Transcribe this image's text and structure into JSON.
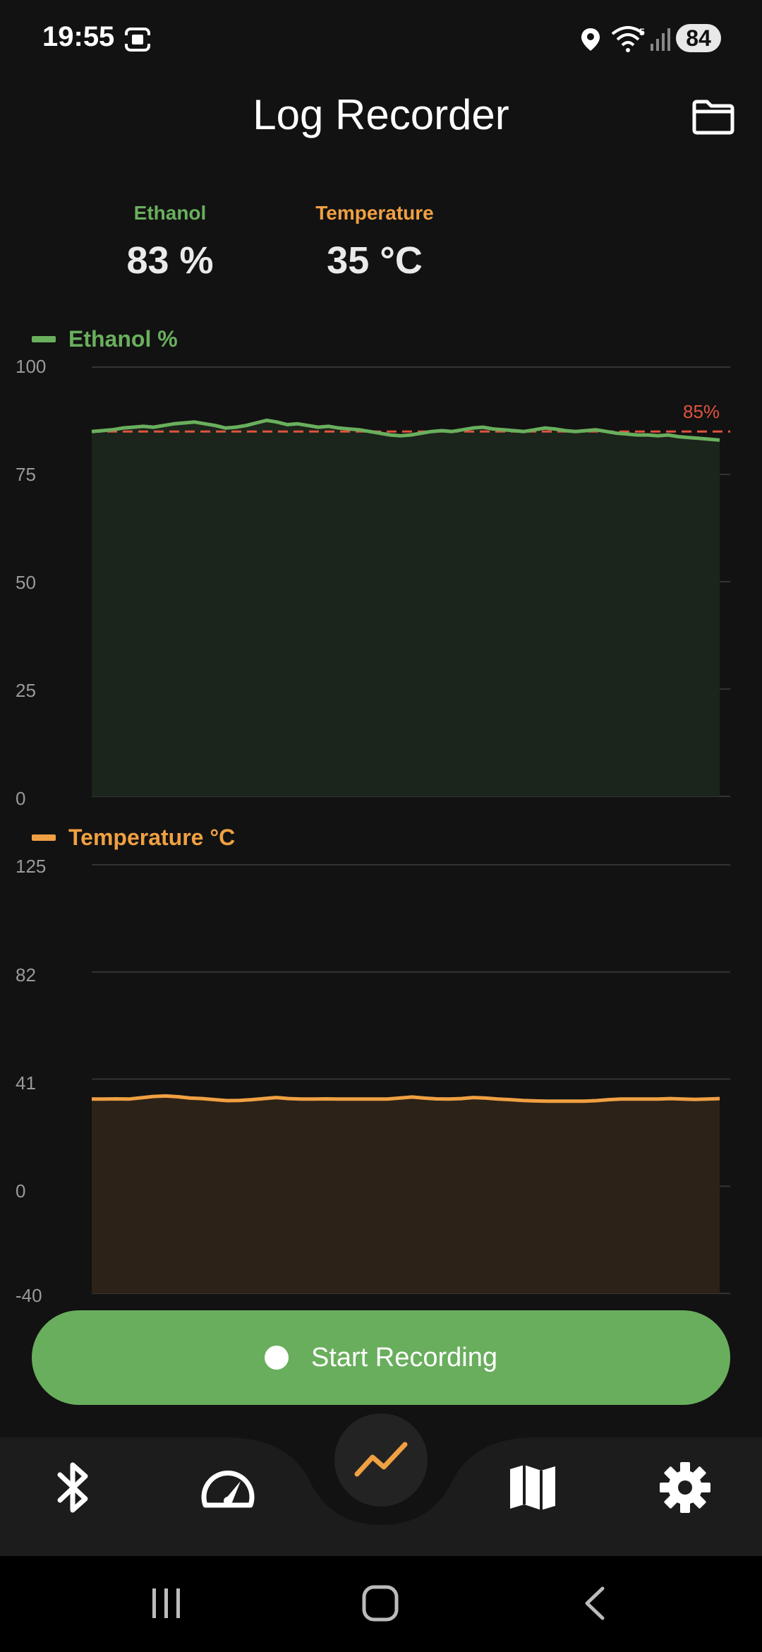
{
  "status_bar": {
    "time": "19:55",
    "battery": "84",
    "icons": [
      "screenshot-icon",
      "location-icon",
      "wifi-icon",
      "signal-icon"
    ]
  },
  "header": {
    "title": "Log Recorder",
    "folder_icon": "folder-icon"
  },
  "readouts": {
    "ethanol_label": "Ethanol",
    "ethanol_value": "83 %",
    "temperature_label": "Temperature",
    "temperature_value": "35 °C"
  },
  "colors": {
    "ethanol": "#6aaf5d",
    "temperature": "#f0a042",
    "threshold": "#e0533f",
    "record_button": "#69ae5d"
  },
  "chart_data": [
    {
      "type": "area",
      "legend": "Ethanol %",
      "yticks": [
        "100",
        "75",
        "50",
        "25",
        "0"
      ],
      "ylim": [
        0,
        100
      ],
      "threshold_label": "85%",
      "threshold": 85,
      "grid": true,
      "series": [
        {
          "values": [
            85,
            85.2,
            85.4,
            85.8,
            86,
            86.2,
            86,
            86.4,
            86.8,
            87,
            87.2,
            86.8,
            86.4,
            85.8,
            86,
            86.4,
            87,
            87.6,
            87.2,
            86.6,
            86.8,
            86.4,
            86,
            86.2,
            85.8,
            85.6,
            85.4,
            85,
            84.6,
            84.2,
            84,
            84.2,
            84.6,
            85,
            85.2,
            85,
            85.4,
            85.8,
            86,
            85.6,
            85.4,
            85.2,
            85,
            85.4,
            85.8,
            85.6,
            85.2,
            85,
            85.2,
            85.4,
            85,
            84.6,
            84.4,
            84.2,
            84.2,
            84,
            84.2,
            83.8,
            83.6,
            83.4,
            83.2,
            83
          ]
        }
      ]
    },
    {
      "type": "area",
      "legend": "Temperature °C",
      "yticks": [
        "125",
        "82",
        "41",
        "0",
        "-40"
      ],
      "ylim": [
        -40,
        125
      ],
      "grid": true,
      "series": [
        {
          "values": [
            34.8,
            34.8,
            34.9,
            34.8,
            35.3,
            35.8,
            36,
            35.7,
            35.2,
            35,
            34.6,
            34.2,
            34.3,
            34.6,
            35,
            35.4,
            35,
            34.8,
            34.8,
            34.9,
            34.8,
            34.8,
            34.8,
            34.8,
            34.8,
            35.2,
            35.6,
            35.2,
            34.9,
            34.8,
            35,
            35.4,
            35.2,
            34.8,
            34.6,
            34.3,
            34.1,
            34,
            34,
            34,
            34,
            34.2,
            34.6,
            34.8,
            34.8,
            34.8,
            34.8,
            35,
            34.8,
            34.7,
            34.8,
            35
          ]
        }
      ]
    }
  ],
  "record_button": {
    "label": "Start Recording"
  },
  "bottom_nav": {
    "items": [
      "bluetooth-icon",
      "speedometer-icon",
      "chart-trend-icon",
      "map-icon",
      "gear-icon"
    ],
    "active": "chart-trend-icon"
  },
  "system_nav": {
    "items": [
      "recent-apps-icon",
      "home-icon",
      "back-icon"
    ]
  }
}
